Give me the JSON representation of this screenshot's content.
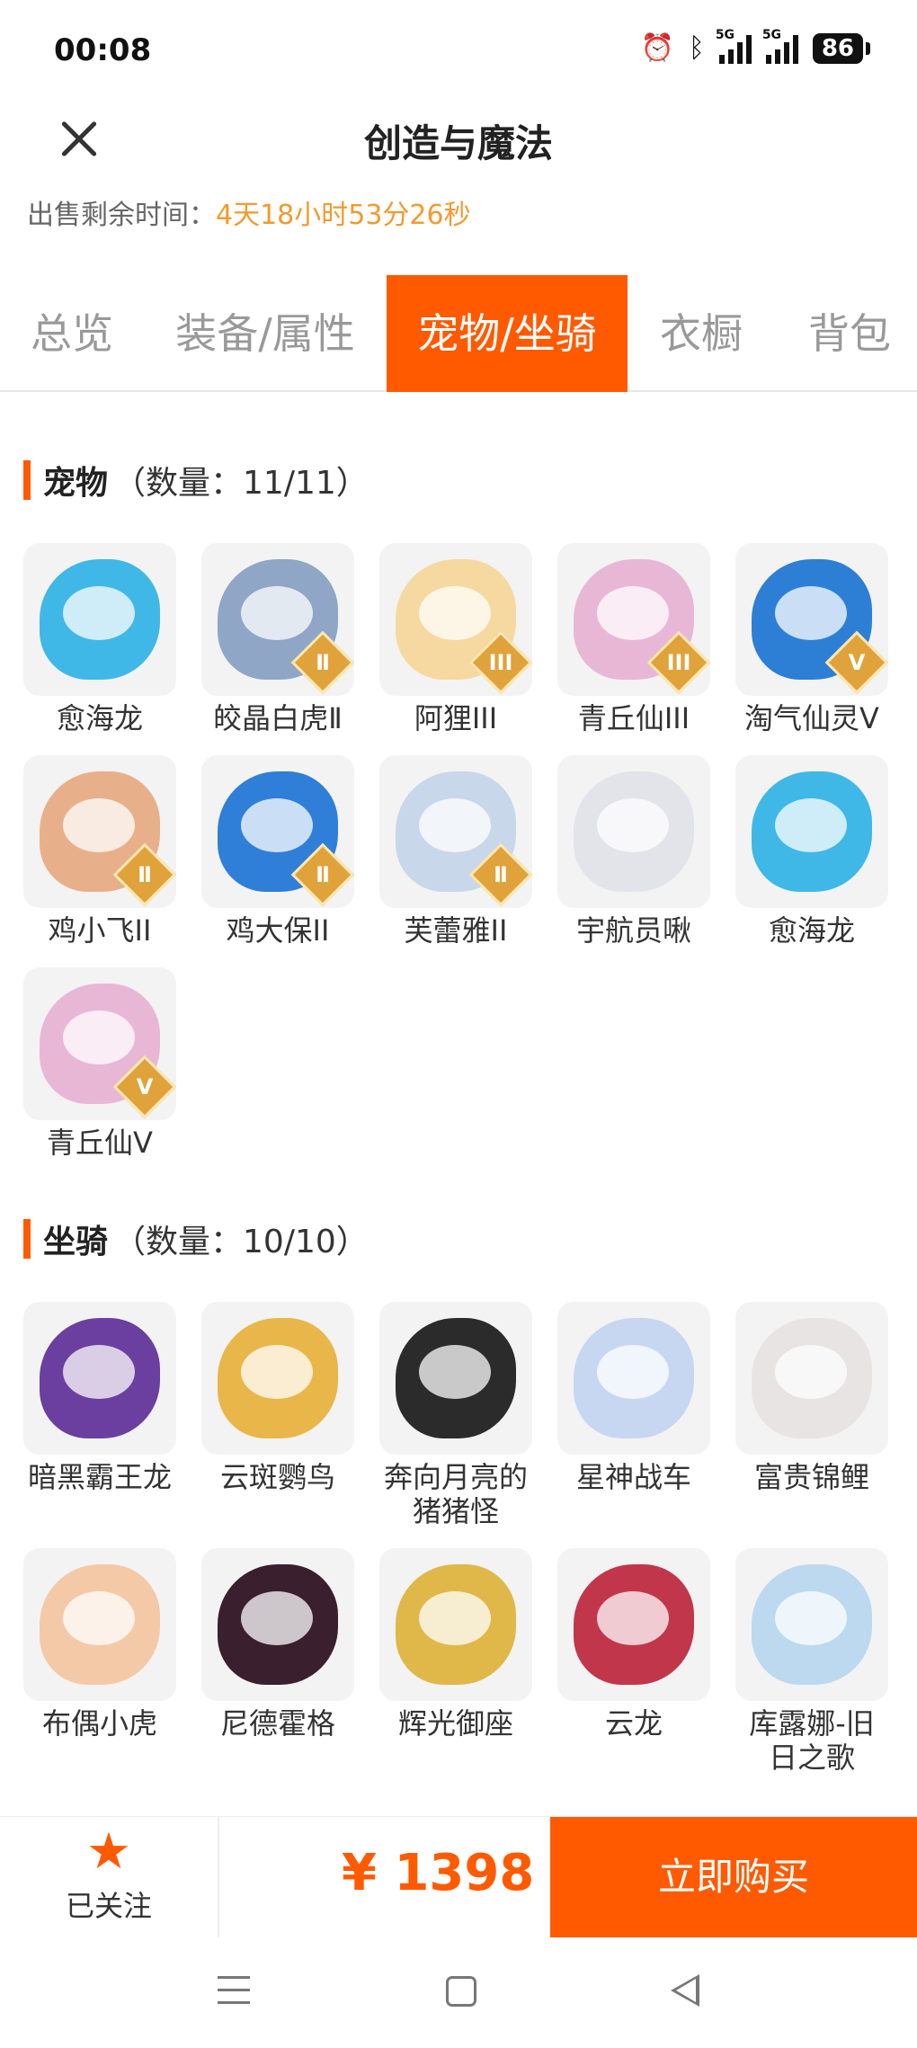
{
  "status_bar": {
    "time": "00:08",
    "network": "5G",
    "battery": "86"
  },
  "header": {
    "title": "创造与魔法"
  },
  "sale": {
    "label": "出售剩余时间：",
    "value": "4天18小时53分26秒"
  },
  "tabs": [
    {
      "label": "总览"
    },
    {
      "label": "装备/属性"
    },
    {
      "label": "宠物/坐骑",
      "active": true
    },
    {
      "label": "衣橱"
    },
    {
      "label": "背包"
    }
  ],
  "pets": {
    "title": "宠物",
    "count": "（数量：11/11）",
    "items": [
      {
        "name": "愈海龙",
        "tier": "",
        "color": "#3fb8e8"
      },
      {
        "name": "皎晶白虎Ⅱ",
        "tier": "Ⅱ",
        "color": "#8fa6c6"
      },
      {
        "name": "阿狸III",
        "tier": "III",
        "color": "#f5d9a0"
      },
      {
        "name": "青丘仙III",
        "tier": "III",
        "color": "#e9b7d6"
      },
      {
        "name": "淘气仙灵V",
        "tier": "V",
        "color": "#2d7fd6"
      },
      {
        "name": "鸡小飞II",
        "tier": "Ⅱ",
        "color": "#e8b08a"
      },
      {
        "name": "鸡大保II",
        "tier": "Ⅱ",
        "color": "#2f7fd8"
      },
      {
        "name": "芙蕾雅II",
        "tier": "Ⅱ",
        "color": "#c9d7ea"
      },
      {
        "name": "宇航员啾",
        "tier": "",
        "color": "#e2e4ea"
      },
      {
        "name": "愈海龙",
        "tier": "",
        "color": "#3fb8e8"
      },
      {
        "name": "青丘仙V",
        "tier": "V",
        "color": "#e9b7d6"
      }
    ]
  },
  "mounts": {
    "title": "坐骑",
    "count": "（数量：10/10）",
    "items": [
      {
        "name": "暗黑霸王龙",
        "color": "#6b3fa0"
      },
      {
        "name": "云斑鹦鸟",
        "color": "#e9b64a"
      },
      {
        "name": "奔向月亮的猪猪怪",
        "color": "#2b2b2b"
      },
      {
        "name": "星神战车",
        "color": "#c7d7f2"
      },
      {
        "name": "富贵锦鲤",
        "color": "#e8e4e4"
      },
      {
        "name": "布偶小虎",
        "color": "#f4c9a8"
      },
      {
        "name": "尼德霍格",
        "color": "#3a1f2e"
      },
      {
        "name": "辉光御座",
        "color": "#e0b84a"
      },
      {
        "name": "云龙",
        "color": "#c2364b"
      },
      {
        "name": "库露娜-旧日之歌",
        "color": "#bcd9ef"
      }
    ]
  },
  "bottom": {
    "follow_label": "已关注",
    "price": "¥ 1398",
    "buy_label": "立即购买"
  },
  "icons": [
    "close-icon",
    "star-icon",
    "alarm-icon",
    "bluetooth-icon",
    "signal-icon",
    "battery-icon",
    "nav-menu-icon",
    "nav-home-icon",
    "nav-back-icon"
  ]
}
